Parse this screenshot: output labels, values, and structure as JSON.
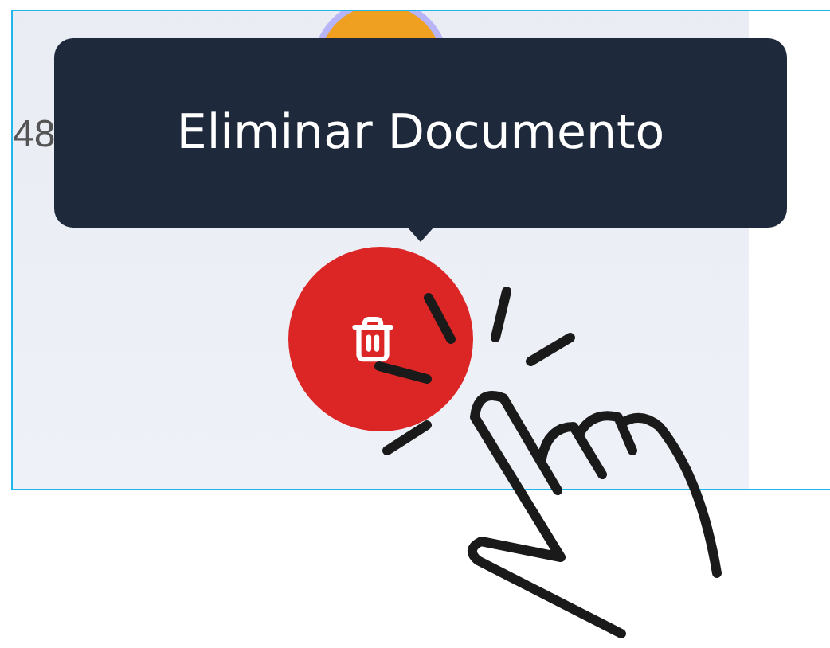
{
  "cell_text": "48",
  "tooltip": {
    "text": "Eliminar Documento"
  },
  "delete_button": {
    "kind": "danger"
  }
}
